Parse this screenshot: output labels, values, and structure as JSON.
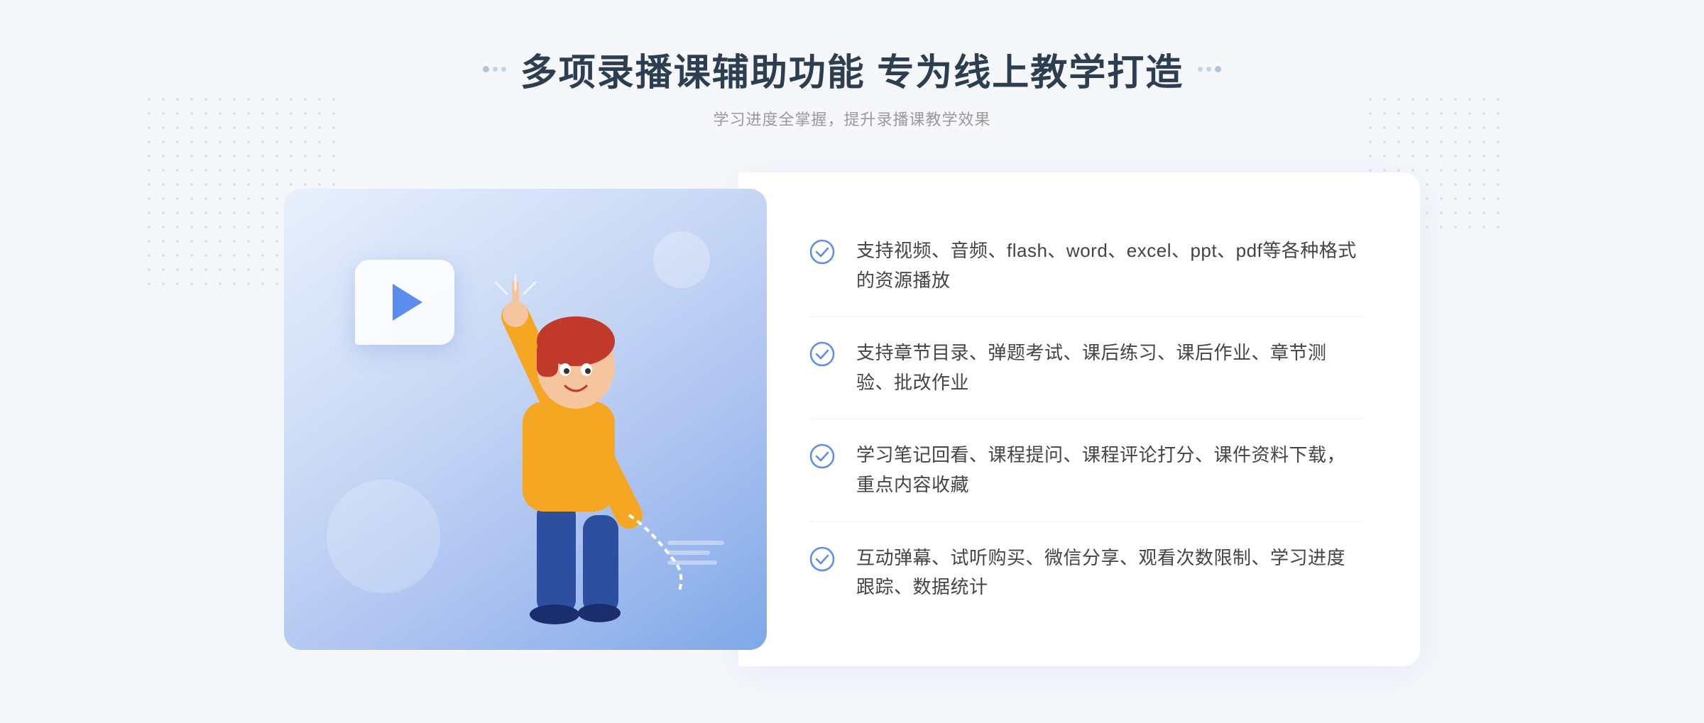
{
  "header": {
    "title": "多项录播课辅助功能 专为线上教学打造",
    "subtitle": "学习进度全掌握，提升录播课教学效果"
  },
  "features": [
    {
      "id": "feature-1",
      "text": "支持视频、音频、flash、word、excel、ppt、pdf等各种格式的资源播放"
    },
    {
      "id": "feature-2",
      "text": "支持章节目录、弹题考试、课后练习、课后作业、章节测验、批改作业"
    },
    {
      "id": "feature-3",
      "text": "学习笔记回看、课程提问、课程评论打分、课件资料下载，重点内容收藏"
    },
    {
      "id": "feature-4",
      "text": "互动弹幕、试听购买、微信分享、观看次数限制、学习进度跟踪、数据统计"
    }
  ],
  "colors": {
    "accent": "#5b8dee",
    "check": "#5b8dee",
    "title": "#2c3e50",
    "subtitle": "#999999",
    "feature_text": "#444444"
  }
}
